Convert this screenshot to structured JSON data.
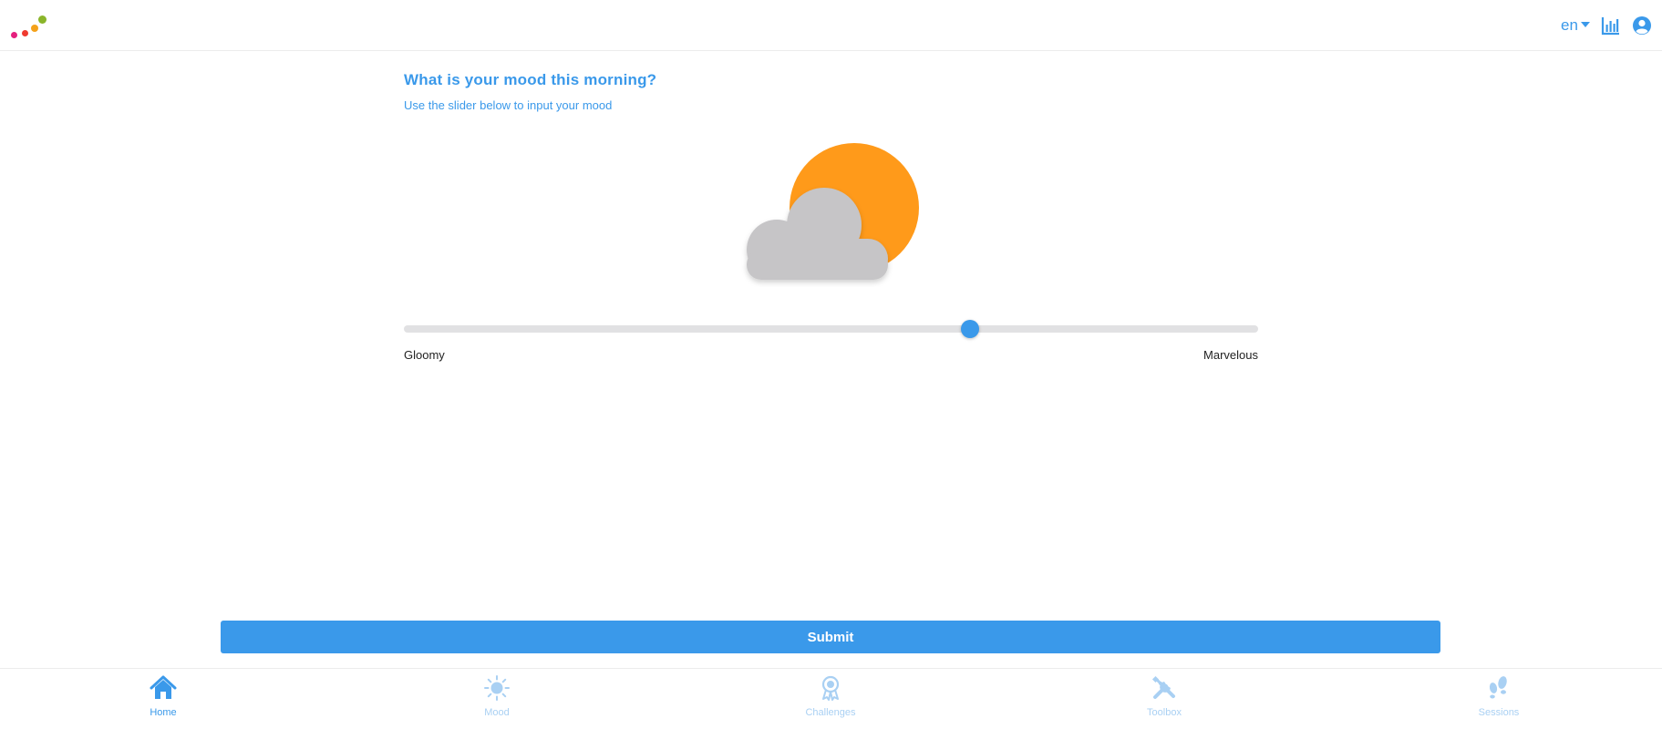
{
  "header": {
    "language": "en",
    "icons": [
      "chart-icon",
      "user-icon"
    ]
  },
  "colors": {
    "accent": "#3a99ea",
    "accent_light": "#a9d0f3",
    "sun": "#ff9a1a",
    "cloud": "#c6c5c7",
    "logo_dots": [
      "#e5207e",
      "#ef3a2f",
      "#f4a21b",
      "#8ab52a"
    ]
  },
  "main": {
    "title": "What is your mood this morning?",
    "subtitle": "Use the slider below to input your mood",
    "illustration": "sun-behind-cloud-icon",
    "slider": {
      "value_fraction": 0.663,
      "min_label": "Gloomy",
      "max_label": "Marvelous"
    },
    "submit_label": "Submit"
  },
  "bottom_nav": {
    "items": [
      {
        "label": "Home",
        "icon": "home-icon",
        "active": true
      },
      {
        "label": "Mood",
        "icon": "sun-icon",
        "active": false
      },
      {
        "label": "Challenges",
        "icon": "award-icon",
        "active": false
      },
      {
        "label": "Toolbox",
        "icon": "tools-icon",
        "active": false
      },
      {
        "label": "Sessions",
        "icon": "footsteps-icon",
        "active": false
      }
    ]
  }
}
